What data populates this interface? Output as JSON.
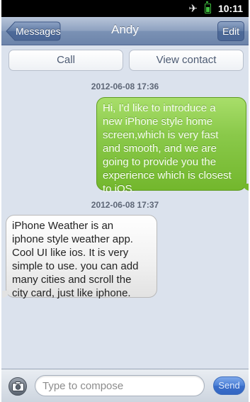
{
  "status_bar": {
    "time": "10:11",
    "airplane_icon": "airplane-icon",
    "battery_icon": "battery-icon"
  },
  "nav": {
    "back_label": "Messages",
    "title": "Andy",
    "edit_label": "Edit"
  },
  "actions": {
    "call_label": "Call",
    "contact_label": "View contact"
  },
  "conversation": [
    {
      "timestamp": "2012-06-08 17:36",
      "direction": "sent",
      "lines": [
        "Hi, I'd like to introduce a",
        "new iPhone style home",
        "screen,which is very fast",
        "and smooth, and we are",
        "going to provide you the",
        "experience which is closest",
        "to iOS."
      ]
    },
    {
      "timestamp": "2012-06-08 17:37",
      "direction": "received",
      "lines": [
        "iPhone Weather is an",
        "iphone style weather app.",
        "Cool UI like ios. It is very",
        "simple to use. you can add",
        "many cities and scroll the",
        "city card, just like iphone."
      ]
    }
  ],
  "compose": {
    "placeholder": "Type to compose",
    "send_label": "Send",
    "camera_icon": "camera-icon"
  },
  "colors": {
    "sent_bubble": "#8ac94a",
    "received_bubble": "#f0f0f0",
    "nav_bar": "#7b92b5",
    "send_button": "#4a7fd6"
  }
}
